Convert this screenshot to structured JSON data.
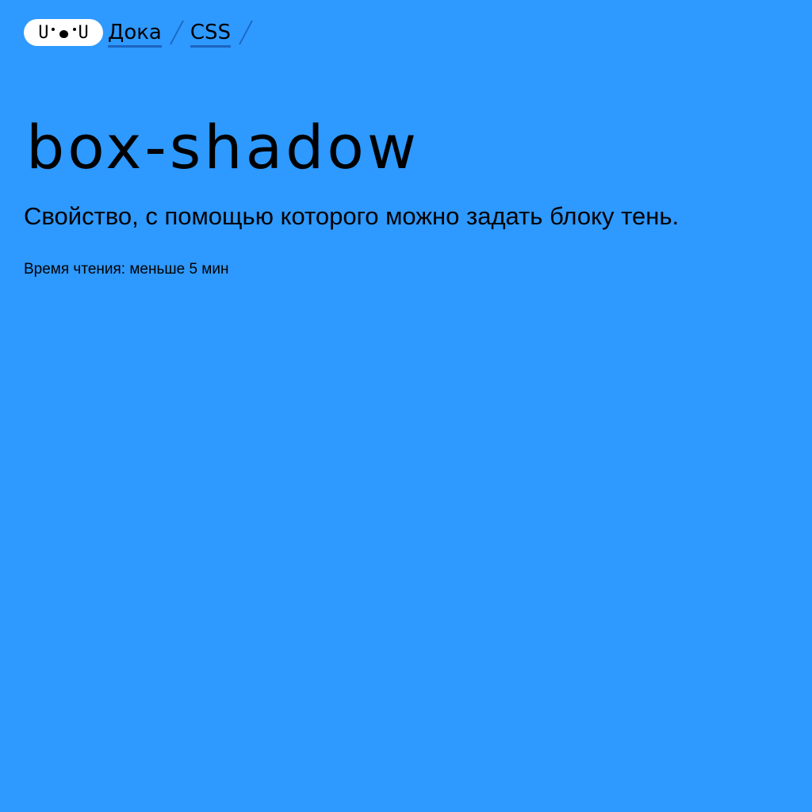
{
  "header": {
    "logo_text": {
      "left": "U",
      "right": "U"
    },
    "breadcrumb": [
      {
        "label": "Дока"
      },
      {
        "label": "CSS"
      }
    ]
  },
  "article": {
    "title": "box-shadow",
    "description": "Свойство, с помощью которого можно задать блоку тень.",
    "reading_time": "Время чтения: меньше 5 мин"
  },
  "colors": {
    "background": "#2e99ff",
    "text": "#000000",
    "logo_background": "#ffffff",
    "link_underline": "#1b65c0"
  }
}
